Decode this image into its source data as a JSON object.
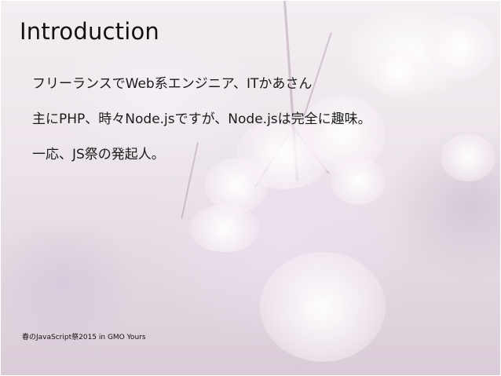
{
  "slide": {
    "title": "Introduction",
    "lines": [
      "フリーランスでWeb系エンジニア、ITかあさん",
      "主にPHP、時々Node.jsですが、Node.jsは完全に趣味。",
      "一応、JS祭の発起人。"
    ],
    "footer": "春のJavaScript祭2015 in GMO Yours"
  }
}
